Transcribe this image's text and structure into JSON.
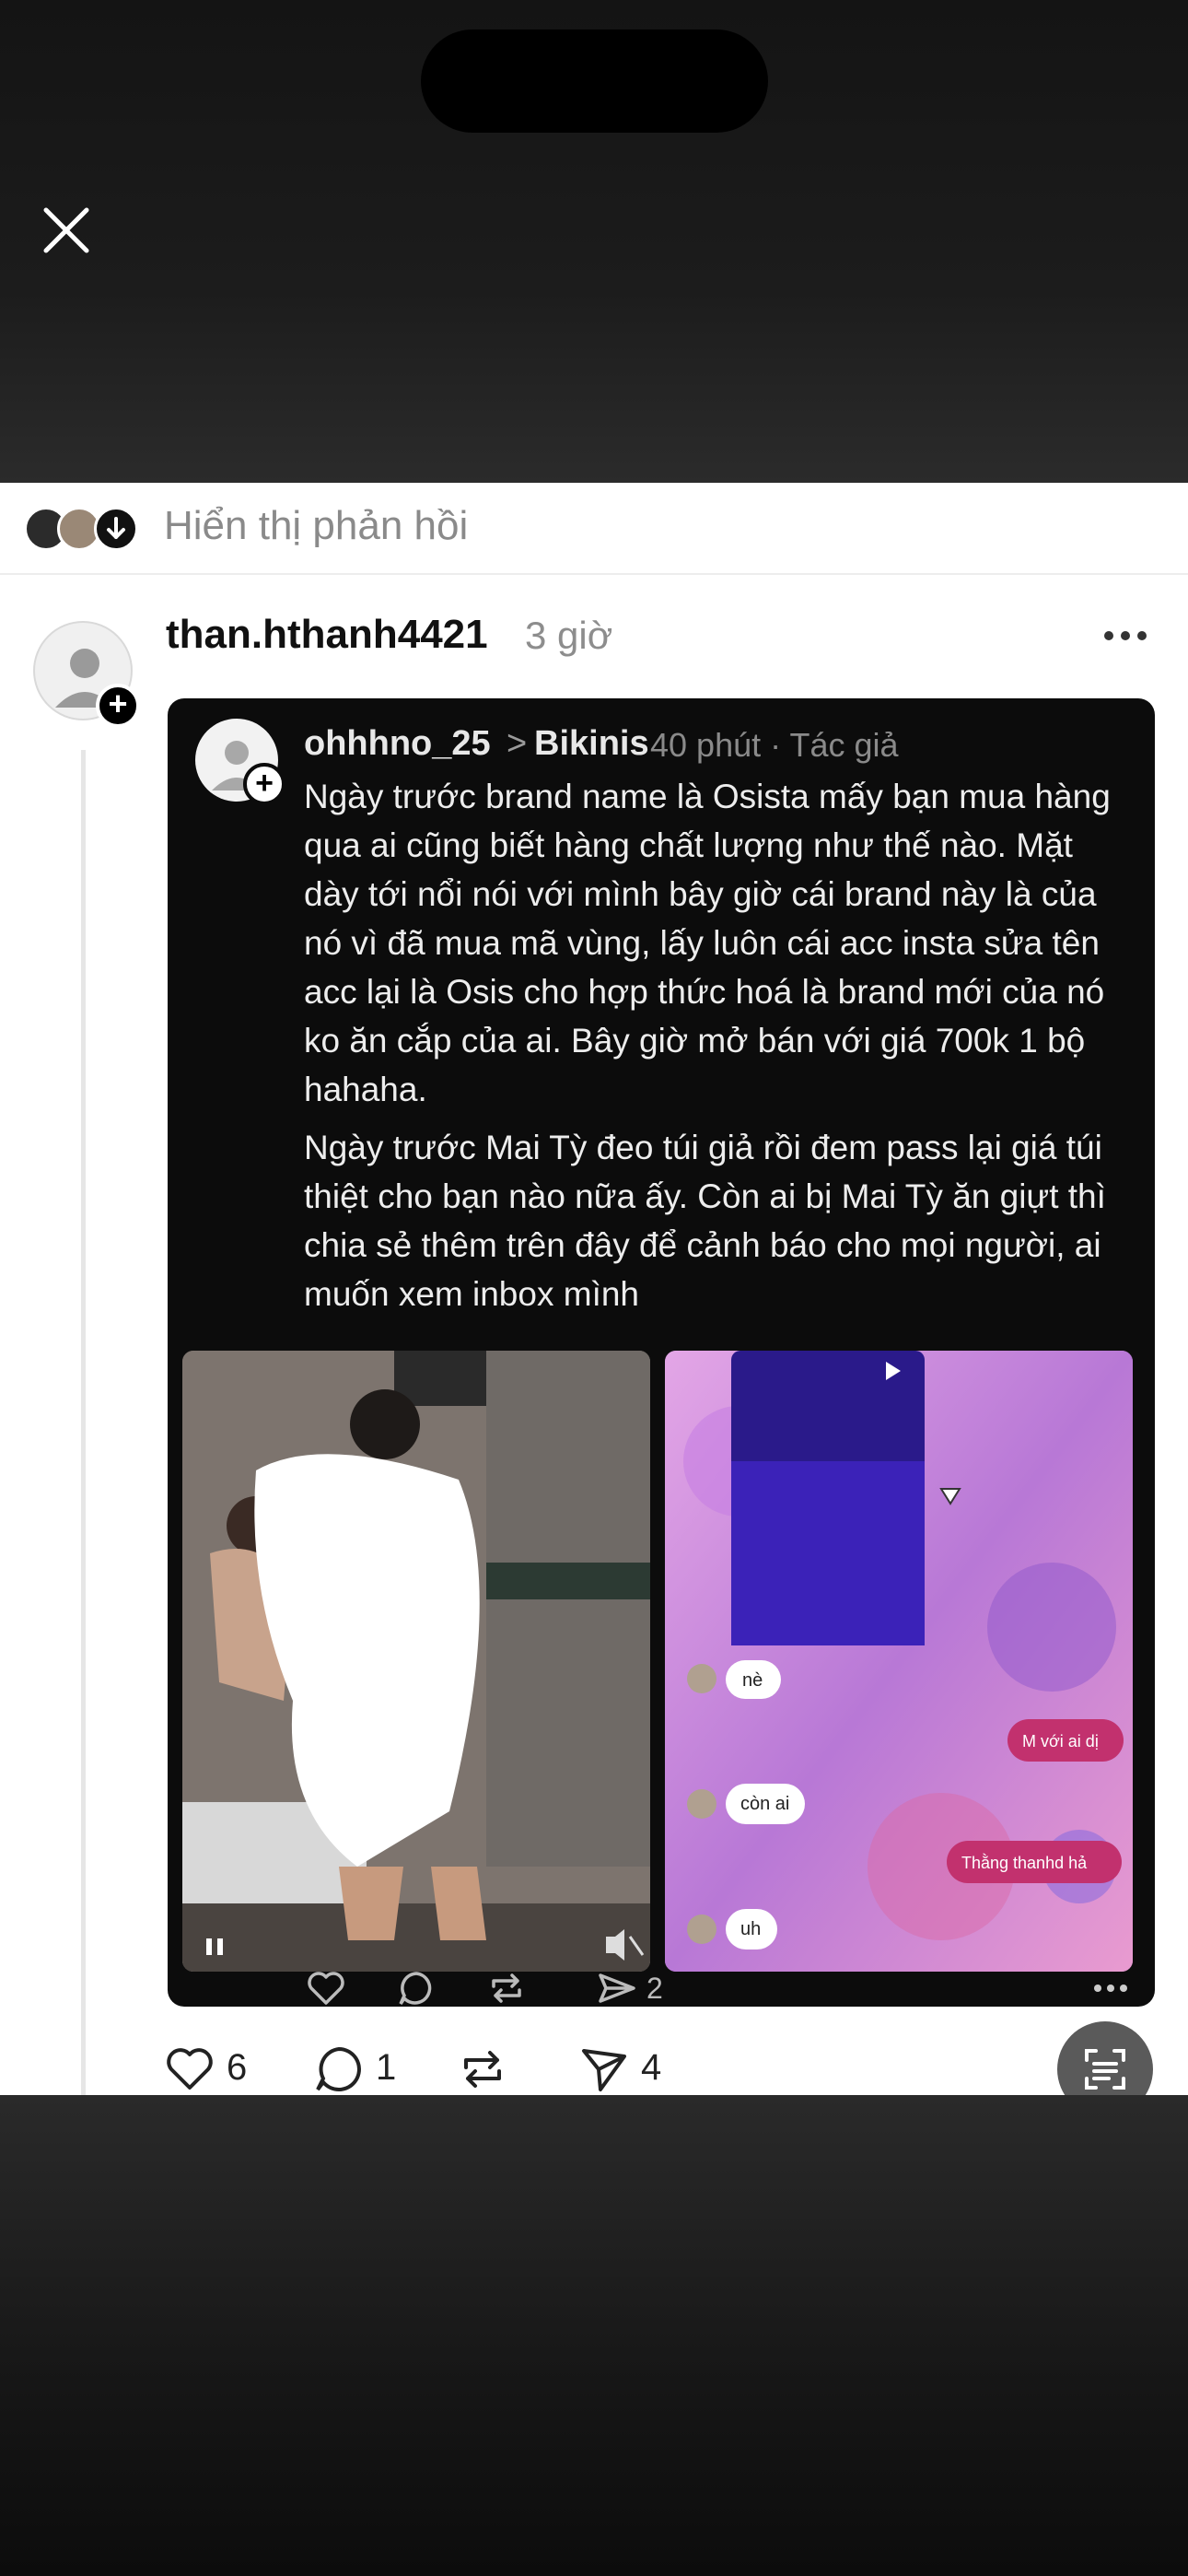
{
  "replies": {
    "label": "Hiển thị phản hồi"
  },
  "post": {
    "username": "than.hthanh4421",
    "time": "3 giờ",
    "likes": "6",
    "comments": "1",
    "shares": "4"
  },
  "embedded": {
    "username": "ohhhno_25",
    "chevron": ">",
    "topic": "Bikinis",
    "meta": "40 phút · Tác giả",
    "paragraph1": "Ngày trước brand name là Osista mấy bạn mua hàng qua ai cũng biết hàng chất lượng như thế nào. Mặt dày tới nổi nói với mình bây giờ cái brand này là của nó vì đã mua mã vùng, lấy luôn cái acc insta sửa tên acc lại là Osis cho hợp thức hoá là brand mới của nó ko ăn cắp của ai. Bây giờ mở bán với giá 700k 1 bộ hahaha.",
    "paragraph2": "Ngày trước Mai Tỳ đeo túi giả rồi đem pass lại giá túi thiệt cho bạn nào nữa ấy. Còn ai bị Mai Tỳ ăn giựt thì chia sẻ thêm trên đây để cảnh báo cho mọi người, ai muốn xem inbox mình",
    "send_count": "2",
    "chat": {
      "msg1": "nè",
      "msg2": "M với ai dị",
      "msg3": "còn ai",
      "msg4": "Thằng thanhd hả",
      "msg5": "uh"
    }
  },
  "icons": {
    "close": "close-icon",
    "more": "more-icon",
    "like": "heart-icon",
    "comment": "comment-icon",
    "repost": "repost-icon",
    "share": "send-icon"
  }
}
